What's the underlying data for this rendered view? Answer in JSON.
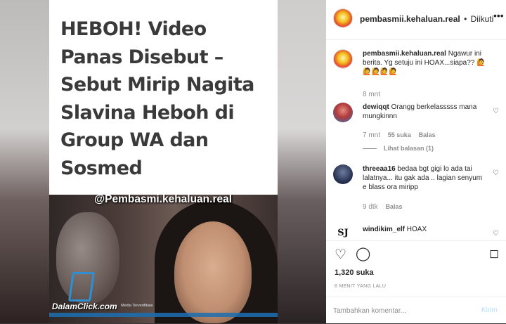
{
  "article": {
    "headline": "HEBOH! Video Panas Disebut – Sebut Mirip Nagita Slavina Heboh di Group WA dan Sosmed",
    "watermark": "@Pembasmi.kehaluan.real",
    "brand": "DalamClick.com",
    "brand_tag": "Media Terverifikasi"
  },
  "post": {
    "username": "pembasmii.kehaluan.real",
    "dot": "•",
    "follow_status": "Diikuti",
    "caption": "Ngawur ini berita. Yg setuju ini HOAX...siapa?? 🙋🙋🙋🙋🙋",
    "caption_time": "8 mnt",
    "likes": "1,320 suka",
    "posted_ago": "8 MENIT YANG LALU"
  },
  "comments": [
    {
      "username": "dewiqqt",
      "text": "Orangg berkelasssss mana mungkinnn",
      "time": "7 mnt",
      "likes": "55 suka",
      "reply": "Balas",
      "view_replies": "Lihat balasan (1)"
    },
    {
      "username": "threeaa16",
      "text": "bedaa bgt gigi lo ada tai lalatnya... itu gak ada .. lagian senyum e blass ora miripp",
      "time": "9 dtk",
      "reply": "Balas"
    },
    {
      "username": "windikim_elf",
      "text": "HOAX",
      "avatar_text": "SJ"
    }
  ],
  "composer": {
    "placeholder": "Tambahkan komentar...",
    "post_label": "Kirim"
  },
  "icons": {
    "more": "more-icon",
    "heart": "heart-icon",
    "comment": "comment-icon",
    "bookmark": "bookmark-icon"
  },
  "colors": {
    "link": "#262626",
    "muted": "#8e8e8e",
    "post_button_disabled": "#b2dffc"
  }
}
